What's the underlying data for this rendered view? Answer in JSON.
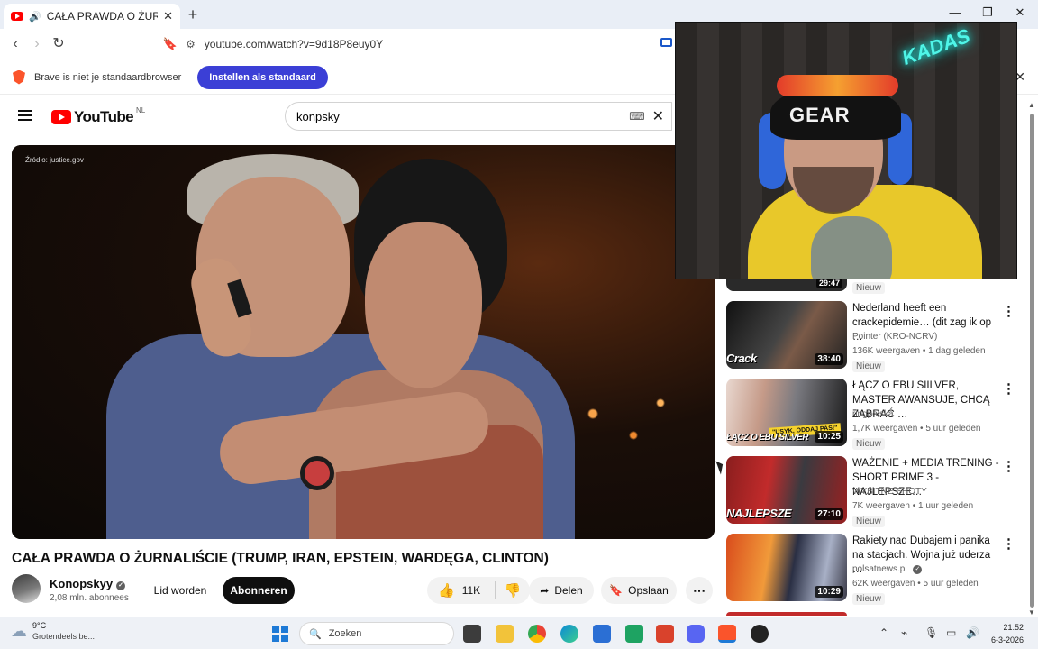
{
  "browser": {
    "tab_title": "CAŁA PRAWDA O ŻURNALIŚC",
    "tab_close": "✕",
    "new_tab": "+",
    "url": "youtube.com/watch?v=9d18P8euy0Y",
    "window_controls": [
      "—",
      "❐",
      "✕"
    ]
  },
  "infobar": {
    "message": "Brave is niet je standaardbrowser",
    "button": "Instellen als standaard",
    "close": "✕"
  },
  "youtube": {
    "logo_word": "YouTube",
    "country": "NL",
    "search_value": "konpsky",
    "clear_icon": "✕"
  },
  "video": {
    "source_label": "Źródło: justice.gov",
    "title": "CAŁA PRAWDA O ŻURNALIŚCIE (TRUMP, IRAN, EPSTEIN, WARDĘGA, CLINTON)",
    "channel_name": "Konopskyy",
    "subscribers": "2,08 mln. abonnees",
    "join_label": "Lid worden",
    "subscribe_label": "Abonneren",
    "likes": "11K",
    "share_label": "Delen",
    "save_label": "Opslaan",
    "more_label": "⋯"
  },
  "webcam": {
    "beanie_text": "GEAR",
    "neon_text": "KADAS"
  },
  "sidebar": {
    "partial_top": {
      "duration": "29:47",
      "badge": "Nieuw"
    },
    "recommendations": [
      {
        "title": "Nederland heeft een crackepidemie… (dit zag ik op …",
        "channel": "Pointer (KRO-NCRV)",
        "meta": "136K weergaven • 1 dag geleden",
        "badge": "Nieuw",
        "duration": "38:40",
        "overlay": "Crack"
      },
      {
        "title": "ŁĄCZ O EBU SIILVER, MASTER AWANSUJE, CHCĄ ZABRAĆ …",
        "channel": "ringpolska",
        "meta": "1,7K weergaven • 5 uur geleden",
        "badge": "Nieuw",
        "duration": "10:25",
        "overlay": "ŁĄCZ O EBU SILVER",
        "quote": "\"USYK, ODDAJ PAS!\""
      },
      {
        "title": "WAŻENIE + MEDIA TRENING - SHORT PRIME 3 - NAJLEPSZE…",
        "channel": "WYBITNE SHOTY",
        "meta": "7K weergaven • 1 uur geleden",
        "badge": "Nieuw",
        "duration": "27:10",
        "overlay": "NAJLEPSZE"
      },
      {
        "title": "Rakiety nad Dubajem i panika na stacjach. Wojna już uderza …",
        "channel": "polsatnews.pl",
        "meta": "62K weergaven • 5 uur geleden",
        "badge": "Nieuw",
        "duration": "10:29",
        "overlay": ""
      }
    ]
  },
  "taskbar": {
    "temperature": "9°C",
    "weather_desc": "Grotendeels be...",
    "search_placeholder": "Zoeken",
    "time": "21:52",
    "date": "6-3-2026"
  },
  "colors": {
    "youtube_red": "#ff0000",
    "brave_button": "#3b3fd6",
    "subscribe_bg": "#0f0f0f",
    "taskbar_bg": "#eef1f6"
  }
}
